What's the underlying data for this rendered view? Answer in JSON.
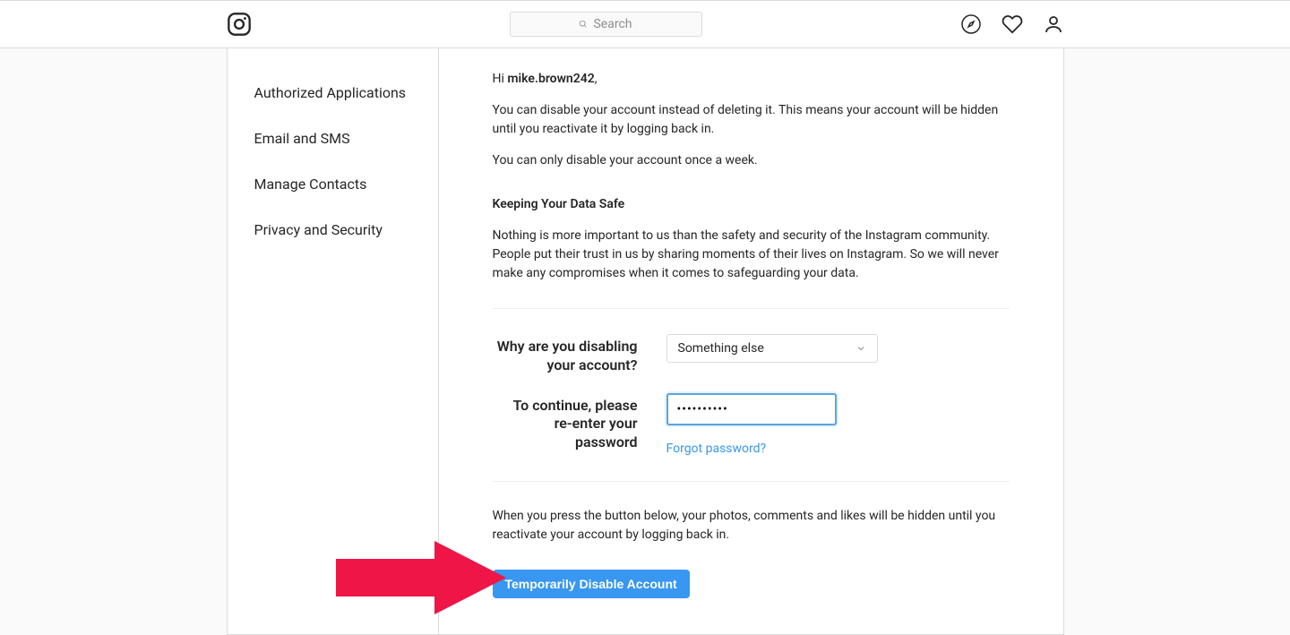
{
  "nav": {
    "search_placeholder": "Search"
  },
  "sidebar": {
    "items": [
      {
        "label": "Authorized Applications"
      },
      {
        "label": "Email and SMS"
      },
      {
        "label": "Manage Contacts"
      },
      {
        "label": "Privacy and Security"
      }
    ]
  },
  "main": {
    "greeting_prefix": "Hi ",
    "username": "mike.brown242",
    "greeting_suffix": ",",
    "para1": "You can disable your account instead of deleting it. This means your account will be hidden until you reactivate it by logging back in.",
    "para2": "You can only disable your account once a week.",
    "heading_safe": "Keeping Your Data Safe",
    "para3": "Nothing is more important to us than the safety and security of the Instagram community. People put their trust in us by sharing moments of their lives on Instagram. So we will never make any compromises when it comes to safeguarding your data.",
    "reason_label": "Why are you disabling your account?",
    "reason_selected": "Something else",
    "password_label": "To continue, please re-enter your password",
    "password_value": "••••••••••",
    "forgot_text": "Forgot password?",
    "bottom_note": "When you press the button below, your photos, comments and likes will be hidden until you reactivate your account by logging back in.",
    "button_label": "Temporarily Disable Account"
  }
}
